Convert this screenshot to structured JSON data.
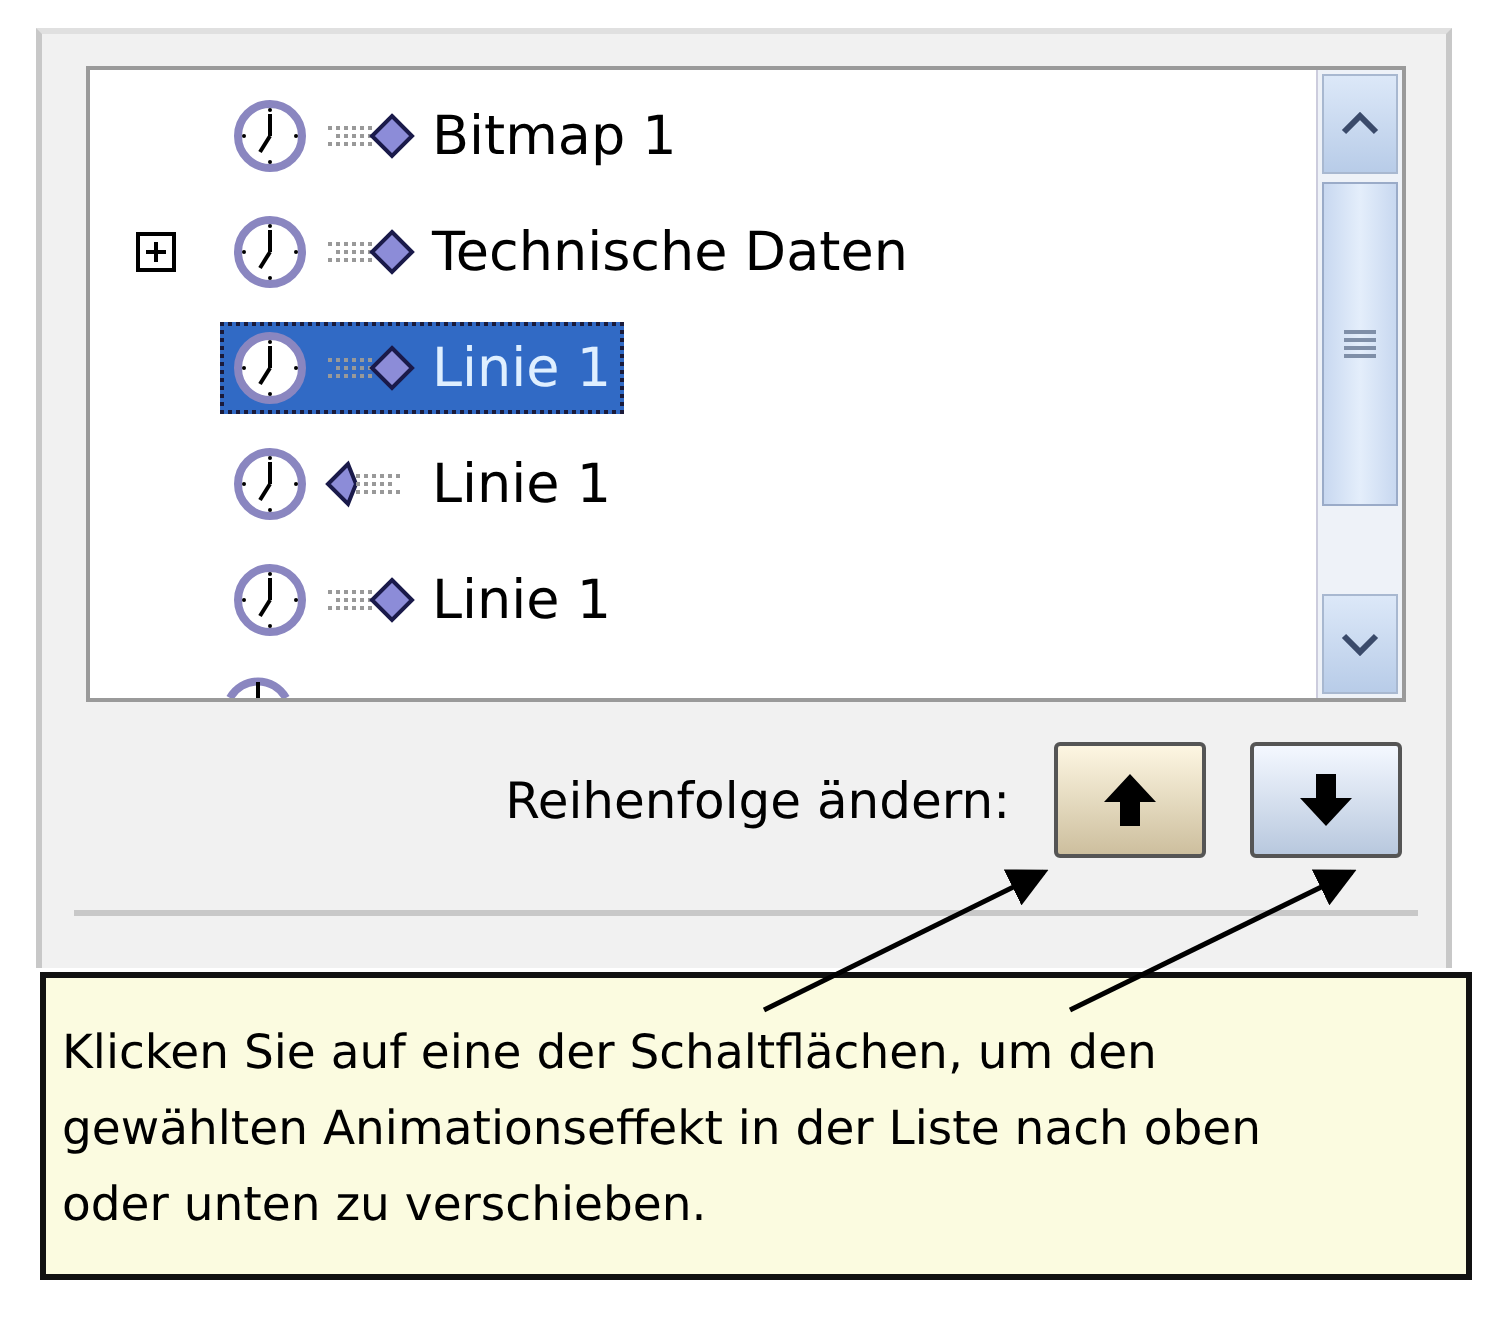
{
  "animation_list": {
    "items": [
      {
        "label": "Bitmap 1",
        "kind": "entrance",
        "selected": false
      },
      {
        "label": "Technische Daten",
        "kind": "entrance",
        "selected": false,
        "expanded": false
      },
      {
        "label": "Linie 1",
        "kind": "entrance",
        "selected": true
      },
      {
        "label": "Linie 1",
        "kind": "exit",
        "selected": false
      },
      {
        "label": "Linie 1",
        "kind": "entrance",
        "selected": false
      }
    ]
  },
  "reorder": {
    "label": "Reihenfolge ändern:",
    "buttons": [
      {
        "kind": "up",
        "hovered": true
      },
      {
        "kind": "down",
        "hovered": false
      }
    ]
  },
  "callout": {
    "text": "Klicken Sie auf eine der Schaltflächen, um den gewählten Animationseffekt in der Liste nach oben oder unten zu verschieben."
  }
}
